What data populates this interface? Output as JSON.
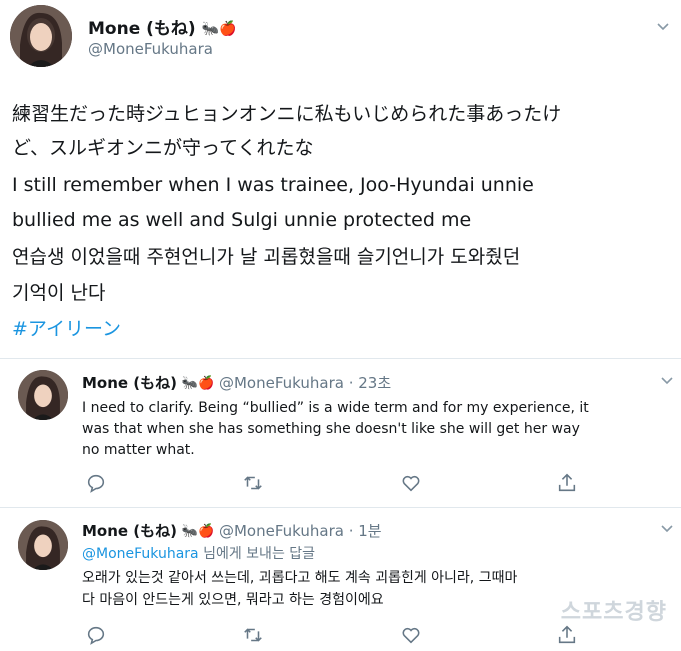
{
  "main_tweet": {
    "name": "Mone (もね)",
    "name_emoji": "🐜🍎",
    "handle": "@MoneFukuhara",
    "lines": [
      "練習生だった時ジュヒョンオンニに私もいじめられた事あったけ",
      "ど、スルギオンニが守ってくれたな",
      "I still remember when I was trainee, Joo-Hyundai unnie",
      "bullied me as well and Sulgi unnie protected me",
      "연습생 이었을때 주현언니가 날 괴롭혔을때 슬기언니가 도와줬던",
      "기억이 난다"
    ],
    "hashtag": "#アイリーン"
  },
  "replies": [
    {
      "name": "Mone (もね)",
      "emoji": "🐜🍎",
      "handle": "@MoneFukuhara",
      "time": "· 23초",
      "lines": [
        "I need to clarify. Being “bullied” is a wide term and for my experience, it",
        "was that when she has something she doesn't like she will get her way",
        "no matter what."
      ]
    },
    {
      "name": "Mone (もね)",
      "emoji": "🐜🍎",
      "handle": "@MoneFukuhara",
      "time": "· 1분",
      "mention": "@MoneFukuhara",
      "reply_suffix": " 님에게 보내는 답글",
      "lines": [
        "오래가 있는것 같아서 쓰는데, 괴롭다고 해도 계속 괴롭힌게 아니라, 그때마",
        "다 마음이 안드는게 있으면, 뭐라고 하는 경험이에요"
      ]
    }
  ],
  "watermark": "스포츠경향",
  "icons": [
    "reply-icon",
    "retweet-icon",
    "like-icon",
    "share-icon",
    "chevron-down-icon"
  ],
  "colors": {
    "link": "#1b95e0",
    "muted": "#657786",
    "divider": "#e1e8ed"
  }
}
